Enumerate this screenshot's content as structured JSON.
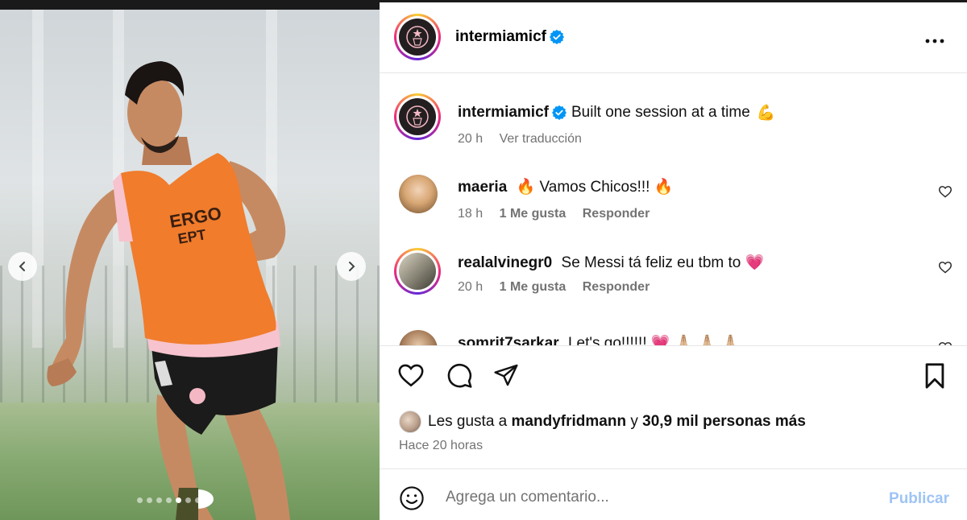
{
  "post": {
    "author": "intermiamicf",
    "verified": true
  },
  "caption": {
    "username": "intermiamicf",
    "text": "Built one session at a time",
    "emoji": "💪",
    "time": "20 h",
    "translate_label": "Ver traducción"
  },
  "comments": [
    {
      "username": "maeria",
      "text": "🔥 Vamos Chicos!!! 🔥",
      "time": "18 h",
      "likes": "1 Me gusta",
      "reply": "Responder"
    },
    {
      "username": "realalvinegr0",
      "text": "Se Messi tá feliz eu tbm to 💗",
      "time": "20 h",
      "likes": "1 Me gusta",
      "reply": "Responder"
    },
    {
      "username": "somrit7sarkar",
      "text": "Let's go!!!!!! 💗 🙏🏼 🙏🏼 🙏🏼"
    }
  ],
  "engagement": {
    "likes_prefix": "Les gusta a",
    "liked_by": "mandyfridmann",
    "likes_connector": "y",
    "likes_rest": "30,9 mil personas más",
    "posted_ago": "Hace 20 horas"
  },
  "composer": {
    "placeholder": "Agrega un comentario...",
    "publish_label": "Publicar"
  },
  "carousel": {
    "slide_count": 8,
    "active_index": 4
  },
  "media_text": {
    "bib_line1": "ERGO",
    "bib_line2": "EPT"
  },
  "colors": {
    "bib": "#f07c2c",
    "verified": "#0095f6",
    "publish_disabled": "#9ec4f5",
    "meta_gray": "#737373"
  },
  "icons": {
    "prev": "chevron-left-icon",
    "next": "chevron-right-icon",
    "more": "more-horizontal-icon",
    "like": "heart-outline-icon",
    "comment": "comment-bubble-icon",
    "share": "paper-plane-icon",
    "save": "bookmark-icon",
    "emoji": "smiley-icon"
  }
}
